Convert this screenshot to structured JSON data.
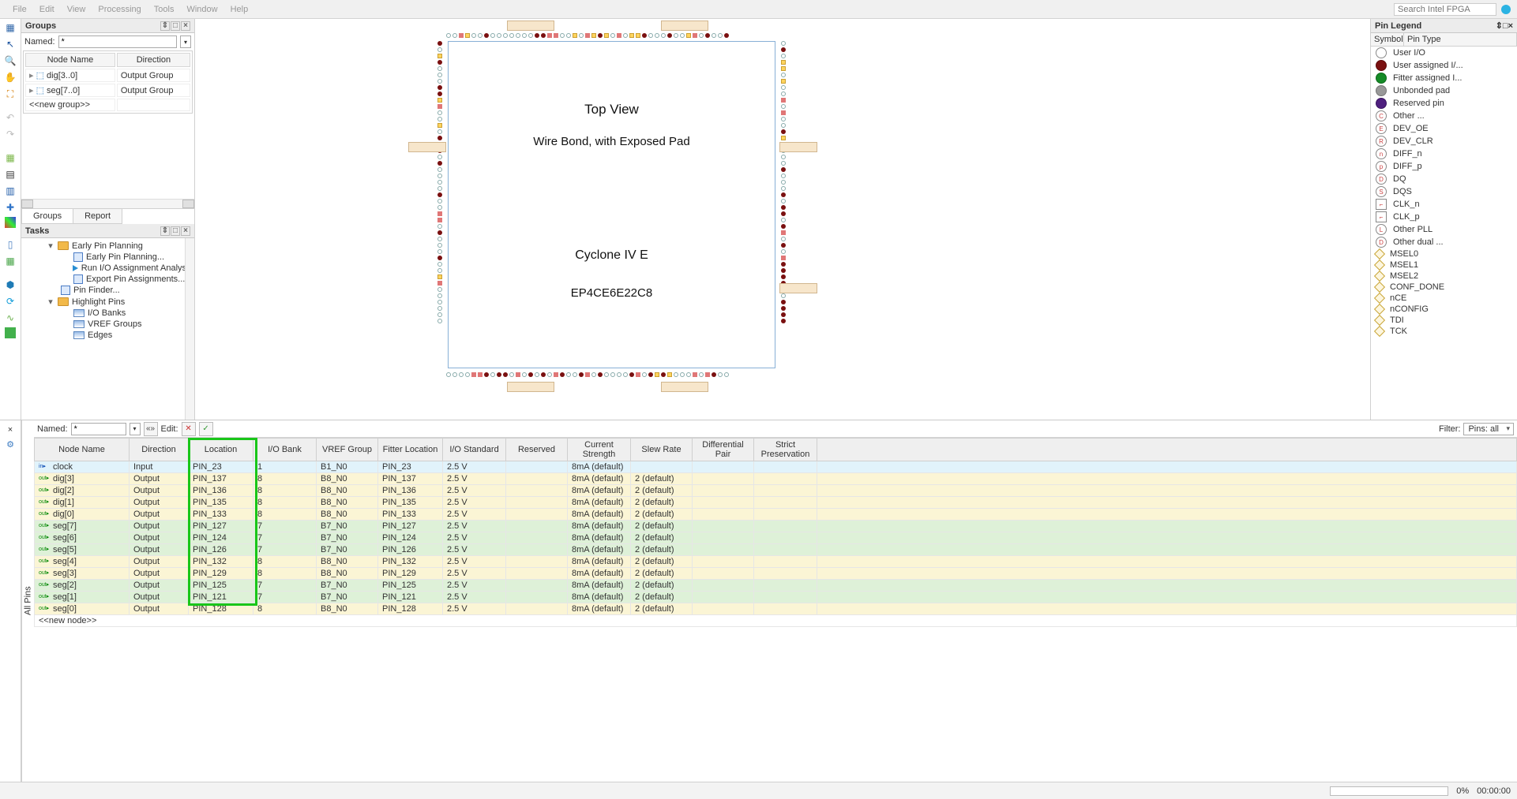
{
  "menu": {
    "file": "File",
    "edit": "Edit",
    "view": "View",
    "processing": "Processing",
    "tools": "Tools",
    "window": "Window",
    "help": "Help"
  },
  "search_placeholder": "Search Intel FPGA",
  "groups_panel": {
    "title": "Groups",
    "named_label": "Named:",
    "named_value": "*",
    "col_node": "Node Name",
    "col_dir": "Direction",
    "rows": [
      {
        "name": "dig[3..0]",
        "dir": "Output Group"
      },
      {
        "name": "seg[7..0]",
        "dir": "Output Group"
      }
    ],
    "new_group": "<<new group>>",
    "tab_groups": "Groups",
    "tab_report": "Report"
  },
  "tasks_panel": {
    "title": "Tasks",
    "items": {
      "early_pin_planning": "Early Pin Planning",
      "early_pin_planning_sub": "Early Pin Planning...",
      "run_io": "Run I/O Assignment Analysis",
      "export_pins": "Export Pin Assignments...",
      "pin_finder": "Pin Finder...",
      "highlight_pins": "Highlight Pins",
      "io_banks": "I/O Banks",
      "vref_groups": "VREF Groups",
      "edges": "Edges"
    }
  },
  "chip": {
    "title1": "Top View",
    "title2": "Wire Bond, with Exposed Pad",
    "title3": "Cyclone IV E",
    "title4": "EP4CE6E22C8"
  },
  "legend": {
    "title": "Pin Legend",
    "col_sym": "Symbol",
    "col_type": "Pin Type",
    "rows": [
      {
        "sym": "circle",
        "label": "User I/O"
      },
      {
        "sym": "solid-dark-red",
        "label": "User assigned I/..."
      },
      {
        "sym": "solid-green",
        "label": "Fitter assigned I..."
      },
      {
        "sym": "solid-gray",
        "label": "Unbonded pad"
      },
      {
        "sym": "solid-purple",
        "label": "Reserved pin"
      },
      {
        "sym": "circle-c",
        "label": "Other ..."
      },
      {
        "sym": "circle-e",
        "label": "DEV_OE"
      },
      {
        "sym": "circle-r",
        "label": "DEV_CLR"
      },
      {
        "sym": "circle-n",
        "label": "DIFF_n"
      },
      {
        "sym": "circle-p",
        "label": "DIFF_p"
      },
      {
        "sym": "circle-d",
        "label": "DQ"
      },
      {
        "sym": "circle-s",
        "label": "DQS"
      },
      {
        "sym": "square-l",
        "label": "CLK_n"
      },
      {
        "sym": "square-f",
        "label": "CLK_p"
      },
      {
        "sym": "circle-l",
        "label": "Other PLL"
      },
      {
        "sym": "circle-d2",
        "label": "Other dual ..."
      },
      {
        "sym": "diamond",
        "label": "MSEL0"
      },
      {
        "sym": "diamond",
        "label": "MSEL1"
      },
      {
        "sym": "diamond",
        "label": "MSEL2"
      },
      {
        "sym": "diamond",
        "label": "CONF_DONE"
      },
      {
        "sym": "diamond",
        "label": "nCE"
      },
      {
        "sym": "diamond",
        "label": "nCONFIG"
      },
      {
        "sym": "diamond",
        "label": "TDI"
      },
      {
        "sym": "diamond",
        "label": "TCK"
      }
    ]
  },
  "pins_toolbar": {
    "named_label": "Named:",
    "named_value": "*",
    "edit_label": "Edit:",
    "filter_label": "Filter:",
    "filter_value": "Pins: all"
  },
  "pins_table": {
    "cols": [
      "Node Name",
      "Direction",
      "Location",
      "I/O Bank",
      "VREF Group",
      "Fitter Location",
      "I/O Standard",
      "Reserved",
      "Current Strength",
      "Slew Rate",
      "Differential Pair",
      "Strict Preservation"
    ],
    "rows": [
      {
        "icon": "in",
        "name": "clock",
        "dir": "Input",
        "loc": "PIN_23",
        "bank": "1",
        "vref": "B1_N0",
        "fit": "PIN_23",
        "std": "2.5 V",
        "res": "",
        "cur": "8mA (default)",
        "slew": "",
        "diff": "",
        "strict": "",
        "cls": "row-blue"
      },
      {
        "icon": "out",
        "name": "dig[3]",
        "dir": "Output",
        "loc": "PIN_137",
        "bank": "8",
        "vref": "B8_N0",
        "fit": "PIN_137",
        "std": "2.5 V",
        "res": "",
        "cur": "8mA (default)",
        "slew": "2 (default)",
        "diff": "",
        "strict": "",
        "cls": "row-yellow"
      },
      {
        "icon": "out",
        "name": "dig[2]",
        "dir": "Output",
        "loc": "PIN_136",
        "bank": "8",
        "vref": "B8_N0",
        "fit": "PIN_136",
        "std": "2.5 V",
        "res": "",
        "cur": "8mA (default)",
        "slew": "2 (default)",
        "diff": "",
        "strict": "",
        "cls": "row-yellow"
      },
      {
        "icon": "out",
        "name": "dig[1]",
        "dir": "Output",
        "loc": "PIN_135",
        "bank": "8",
        "vref": "B8_N0",
        "fit": "PIN_135",
        "std": "2.5 V",
        "res": "",
        "cur": "8mA (default)",
        "slew": "2 (default)",
        "diff": "",
        "strict": "",
        "cls": "row-yellow"
      },
      {
        "icon": "out",
        "name": "dig[0]",
        "dir": "Output",
        "loc": "PIN_133",
        "bank": "8",
        "vref": "B8_N0",
        "fit": "PIN_133",
        "std": "2.5 V",
        "res": "",
        "cur": "8mA (default)",
        "slew": "2 (default)",
        "diff": "",
        "strict": "",
        "cls": "row-yellow"
      },
      {
        "icon": "out",
        "name": "seg[7]",
        "dir": "Output",
        "loc": "PIN_127",
        "bank": "7",
        "vref": "B7_N0",
        "fit": "PIN_127",
        "std": "2.5 V",
        "res": "",
        "cur": "8mA (default)",
        "slew": "2 (default)",
        "diff": "",
        "strict": "",
        "cls": "row-green"
      },
      {
        "icon": "out",
        "name": "seg[6]",
        "dir": "Output",
        "loc": "PIN_124",
        "bank": "7",
        "vref": "B7_N0",
        "fit": "PIN_124",
        "std": "2.5 V",
        "res": "",
        "cur": "8mA (default)",
        "slew": "2 (default)",
        "diff": "",
        "strict": "",
        "cls": "row-green"
      },
      {
        "icon": "out",
        "name": "seg[5]",
        "dir": "Output",
        "loc": "PIN_126",
        "bank": "7",
        "vref": "B7_N0",
        "fit": "PIN_126",
        "std": "2.5 V",
        "res": "",
        "cur": "8mA (default)",
        "slew": "2 (default)",
        "diff": "",
        "strict": "",
        "cls": "row-green"
      },
      {
        "icon": "out",
        "name": "seg[4]",
        "dir": "Output",
        "loc": "PIN_132",
        "bank": "8",
        "vref": "B8_N0",
        "fit": "PIN_132",
        "std": "2.5 V",
        "res": "",
        "cur": "8mA (default)",
        "slew": "2 (default)",
        "diff": "",
        "strict": "",
        "cls": "row-yellow"
      },
      {
        "icon": "out",
        "name": "seg[3]",
        "dir": "Output",
        "loc": "PIN_129",
        "bank": "8",
        "vref": "B8_N0",
        "fit": "PIN_129",
        "std": "2.5 V",
        "res": "",
        "cur": "8mA (default)",
        "slew": "2 (default)",
        "diff": "",
        "strict": "",
        "cls": "row-yellow"
      },
      {
        "icon": "out",
        "name": "seg[2]",
        "dir": "Output",
        "loc": "PIN_125",
        "bank": "7",
        "vref": "B7_N0",
        "fit": "PIN_125",
        "std": "2.5 V",
        "res": "",
        "cur": "8mA (default)",
        "slew": "2 (default)",
        "diff": "",
        "strict": "",
        "cls": "row-green"
      },
      {
        "icon": "out",
        "name": "seg[1]",
        "dir": "Output",
        "loc": "PIN_121",
        "bank": "7",
        "vref": "B7_N0",
        "fit": "PIN_121",
        "std": "2.5 V",
        "res": "",
        "cur": "8mA (default)",
        "slew": "2 (default)",
        "diff": "",
        "strict": "",
        "cls": "row-green"
      },
      {
        "icon": "out",
        "name": "seg[0]",
        "dir": "Output",
        "loc": "PIN_128",
        "bank": "8",
        "vref": "B8_N0",
        "fit": "PIN_128",
        "std": "2.5 V",
        "res": "",
        "cur": "8mA (default)",
        "slew": "2 (default)",
        "diff": "",
        "strict": "",
        "cls": "row-yellow"
      }
    ],
    "new_node": "<<new node>>"
  },
  "allpins_label": "All Pins",
  "status": {
    "pct": "0%",
    "time": "00:00:00"
  }
}
